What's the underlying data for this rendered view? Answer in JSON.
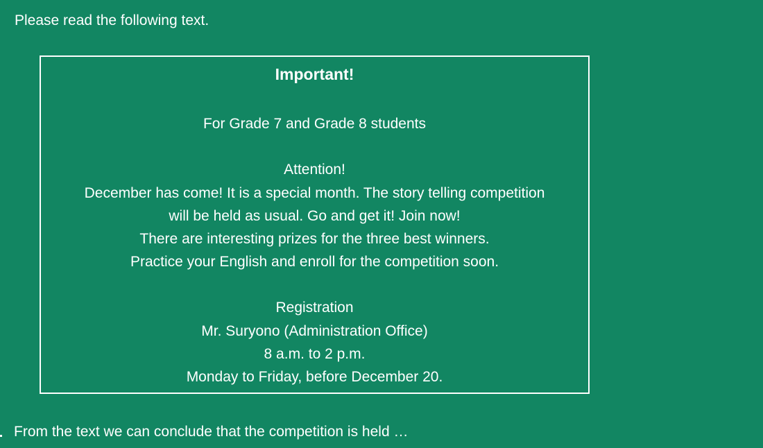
{
  "instruction": "Please read the following text.",
  "notice": {
    "title": "Important!",
    "audience": "For Grade 7 and Grade 8 students",
    "attention": "Attention!",
    "body_1": "December has come! It is a special month. The story telling competition",
    "body_2": "will be held as usual. Go and get it! Join now!",
    "body_3": "There are interesting prizes for the three best winners.",
    "body_4": "Practice your English and enroll for the competition soon.",
    "registration_heading": "Registration",
    "contact": "Mr. Suryono (Administration Office)",
    "hours": "8 a.m. to 2 p.m.",
    "days": "Monday to Friday, before December 20."
  },
  "question": "From the text we can conclude that the competition is held …"
}
